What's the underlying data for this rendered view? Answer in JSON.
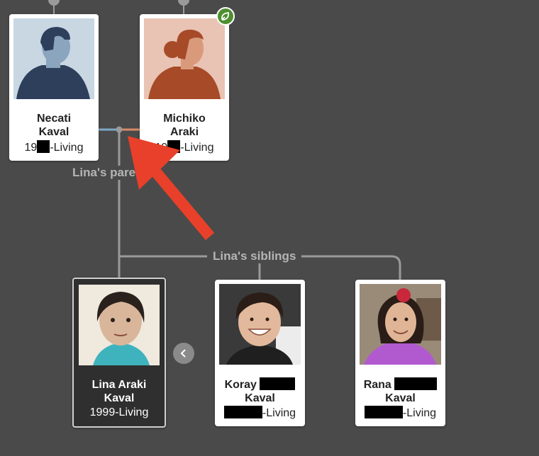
{
  "parents": {
    "label": "Lina's parents",
    "father": {
      "first": "Necati",
      "last": "Kaval",
      "dates_prefix": "19",
      "dates_suffix": "-Living"
    },
    "mother": {
      "first": "Michiko",
      "last": "Araki",
      "dates_prefix": "19",
      "dates_suffix": "-Living"
    }
  },
  "siblings": {
    "label": "Lina's siblings",
    "focus": {
      "first": "Lina Araki",
      "last": "Kaval",
      "dates": "1999-Living"
    },
    "brother": {
      "first": "Koray",
      "last": "Kaval",
      "dates_suffix": "-Living"
    },
    "sister": {
      "first": "Rana",
      "last": "Kaval",
      "dates_suffix": "-Living"
    }
  },
  "icons": {
    "record_hint": "leaf-hint-icon",
    "previous": "chevron-left-icon",
    "annotation": "red-arrow-annotation"
  },
  "colors": {
    "background": "#4a4a4a",
    "arrow": "#e8402a",
    "father_line": "#7fa9c7",
    "mother_line": "#d98a6a",
    "hint_green": "#4e8f2f"
  }
}
